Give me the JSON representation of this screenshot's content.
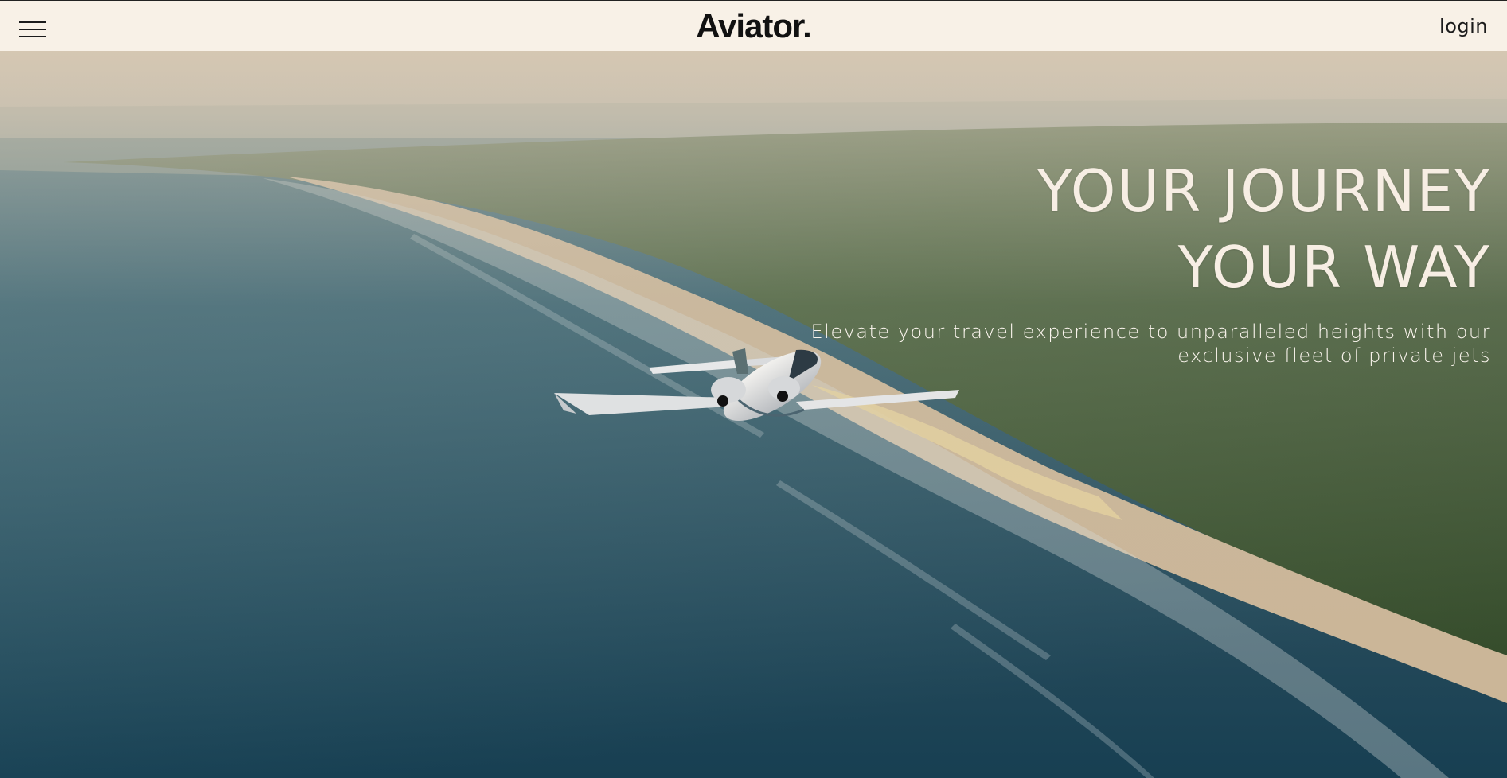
{
  "header": {
    "brand": "Aviator.",
    "login_label": "login",
    "menu_icon": "hamburger-menu-icon"
  },
  "hero": {
    "headline_line1": "YOUR JOURNEY",
    "headline_line2": "YOUR WAY",
    "subtitle_line1": "Elevate your travel experience to unparalleled heights with our",
    "subtitle_line2": "exclusive fleet of private jets",
    "background_image": "private jet flying over coastline"
  },
  "colors": {
    "header_bg": "#f8f1e7",
    "text_dark": "#111111",
    "hero_text": "#f7eee4"
  }
}
